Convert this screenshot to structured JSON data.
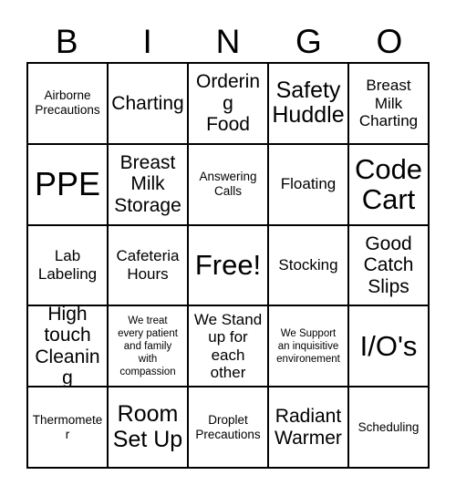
{
  "header": {
    "letters": [
      "B",
      "I",
      "N",
      "G",
      "O"
    ]
  },
  "grid": {
    "rows": [
      [
        {
          "text": "Airborne\nPrecautions",
          "size": "fs-s"
        },
        {
          "text": "Charting",
          "size": "fs-l"
        },
        {
          "text": "Ordering\nFood",
          "size": "fs-l"
        },
        {
          "text": "Safety\nHuddle",
          "size": "fs-xl"
        },
        {
          "text": "Breast\nMilk\nCharting",
          "size": "fs-m"
        }
      ],
      [
        {
          "text": "PPE",
          "size": "fs-huge"
        },
        {
          "text": "Breast\nMilk\nStorage",
          "size": "fs-l"
        },
        {
          "text": "Answering\nCalls",
          "size": "fs-s"
        },
        {
          "text": "Floating",
          "size": "fs-m"
        },
        {
          "text": "Code\nCart",
          "size": "fs-xxl"
        }
      ],
      [
        {
          "text": "Lab\nLabeling",
          "size": "fs-m"
        },
        {
          "text": "Cafeteria\nHours",
          "size": "fs-m"
        },
        {
          "text": "Free!",
          "size": "fs-xxl"
        },
        {
          "text": "Stocking",
          "size": "fs-m"
        },
        {
          "text": "Good\nCatch\nSlips",
          "size": "fs-l"
        }
      ],
      [
        {
          "text": "High\ntouch\nCleaning",
          "size": "fs-l"
        },
        {
          "text": "We treat\nevery patient\nand family\nwith\ncompassion",
          "size": "fs-xs"
        },
        {
          "text": "We Stand\nup for\neach\nother",
          "size": "fs-m"
        },
        {
          "text": "We Support\nan inquisitive\nenvironement",
          "size": "fs-xs"
        },
        {
          "text": "I/O's",
          "size": "fs-xxl"
        }
      ],
      [
        {
          "text": "Thermometer",
          "size": "fs-s"
        },
        {
          "text": "Room\nSet Up",
          "size": "fs-xl"
        },
        {
          "text": "Droplet\nPrecautions",
          "size": "fs-s"
        },
        {
          "text": "Radiant\nWarmer",
          "size": "fs-l"
        },
        {
          "text": "Scheduling",
          "size": "fs-s"
        }
      ]
    ]
  },
  "colors": {
    "background": "#ffffff",
    "border": "#000000",
    "text": "#000000"
  }
}
